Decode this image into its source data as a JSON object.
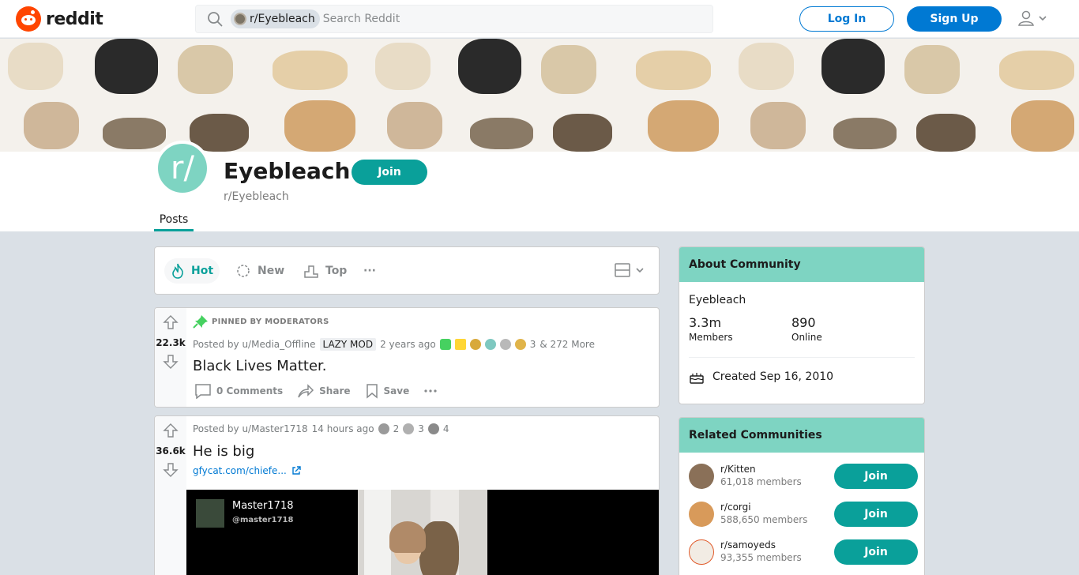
{
  "header": {
    "logo_text": "reddit",
    "search_chip": "r/Eyebleach",
    "search_placeholder": "Search Reddit",
    "login_label": "Log In",
    "signup_label": "Sign Up"
  },
  "community": {
    "avatar_text": "r/",
    "title": "Eyebleach",
    "subreddit": "r/Eyebleach",
    "join_label": "Join",
    "tab": "Posts"
  },
  "sort": {
    "hot": "Hot",
    "new": "New",
    "top": "Top",
    "more": "···"
  },
  "posts": [
    {
      "pinned_label": "PINNED BY MODERATORS",
      "score": "22.3k",
      "posted_by": "Posted by u/Media_Offline",
      "flair": "LAZY MOD",
      "time": "2 years ago",
      "award_count": "3",
      "more_awards": "& 272 More",
      "title": "Black Lives Matter.",
      "comments": "0 Comments",
      "share": "Share",
      "save": "Save"
    },
    {
      "score": "36.6k",
      "posted_by": "Posted by u/Master1718",
      "time": "14 hours ago",
      "award_counts": [
        "2",
        "3",
        "4"
      ],
      "title": "He is big",
      "link": "gfycat.com/chiefe...",
      "media_user": "Master1718",
      "media_handle": "@master1718"
    }
  ],
  "about": {
    "heading": "About Community",
    "name": "Eyebleach",
    "members_value": "3.3m",
    "members_label": "Members",
    "online_value": "890",
    "online_label": "Online",
    "created": "Created Sep 16, 2010"
  },
  "related": {
    "heading": "Related Communities",
    "join_label": "Join",
    "items": [
      {
        "name": "r/Kitten",
        "members": "61,018 members"
      },
      {
        "name": "r/corgi",
        "members": "588,650 members"
      },
      {
        "name": "r/samoyeds",
        "members": "93,355 members"
      }
    ]
  },
  "colors": {
    "accent": "#0aa09a",
    "brand": "#ff4500",
    "primary_blue": "#0079d3",
    "card_header": "#7ed4c2"
  }
}
